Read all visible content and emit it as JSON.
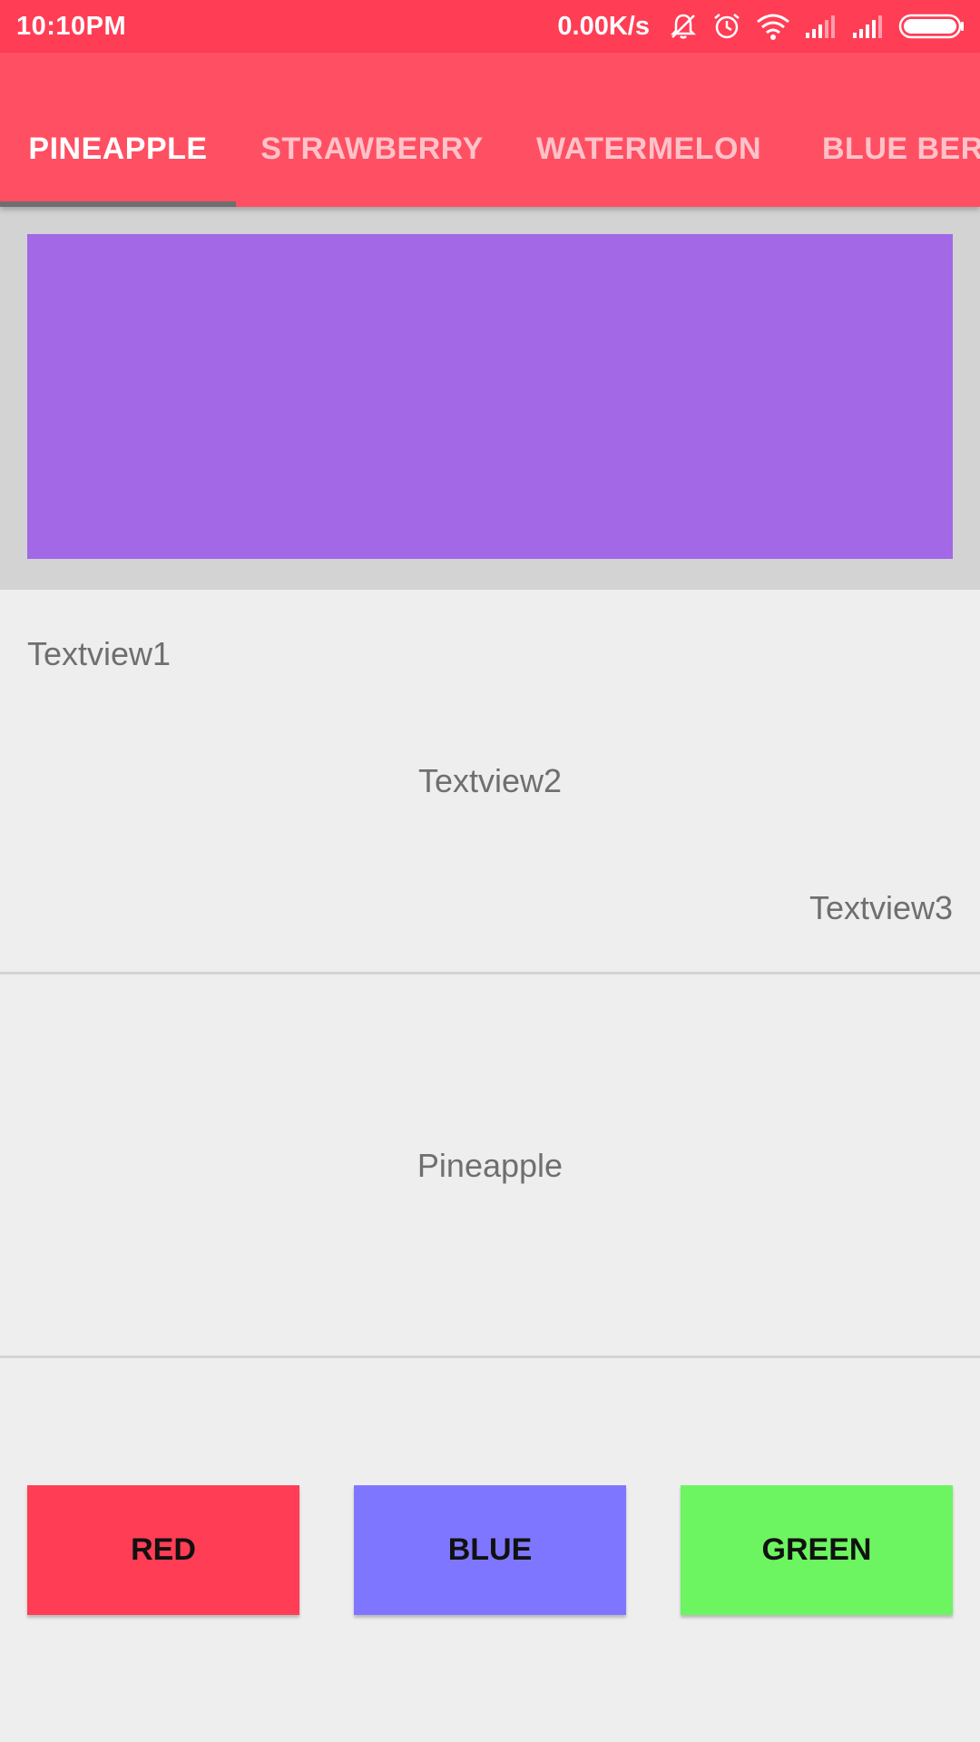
{
  "status_bar": {
    "time": "10:10PM",
    "network_speed": "0.00K/s",
    "icons": [
      "silent-icon",
      "alarm-icon",
      "wifi-icon",
      "signal-icon",
      "signal-icon",
      "battery-icon"
    ]
  },
  "tabs": [
    {
      "label": "PINEAPPLE",
      "selected": true
    },
    {
      "label": "STRAWBERRY",
      "selected": false
    },
    {
      "label": "WATERMELON",
      "selected": false
    },
    {
      "label": "BLUE BERR",
      "selected": false
    }
  ],
  "content": {
    "textview1": "Textview1",
    "textview2": "Textview2",
    "textview3": "Textview3",
    "fruit_label": "Pineapple"
  },
  "buttons": {
    "red": "RED",
    "blue": "BLUE",
    "green": "GREEN"
  },
  "colors": {
    "status_bar": "#ff3d55",
    "app_bar": "#ff4f63",
    "header_panel": "#d3d3d3",
    "purple_block": "#a268e6",
    "red_button": "#ff3d55",
    "blue_button": "#7f76ff",
    "green_button": "#6cf560"
  }
}
